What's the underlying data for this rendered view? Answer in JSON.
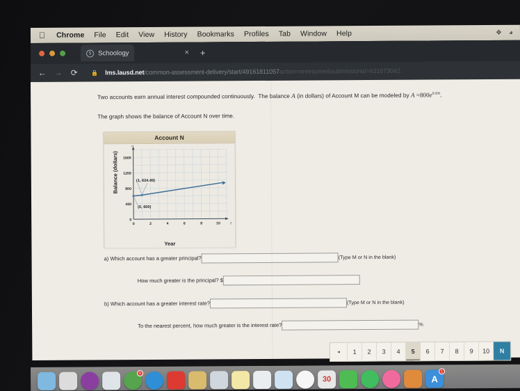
{
  "menubar": {
    "apple_glyph": "",
    "items": [
      {
        "label": "Chrome",
        "bold": true
      },
      {
        "label": "File",
        "bold": false
      },
      {
        "label": "Edit",
        "bold": false
      },
      {
        "label": "View",
        "bold": false
      },
      {
        "label": "History",
        "bold": false
      },
      {
        "label": "Bookmarks",
        "bold": false
      },
      {
        "label": "Profiles",
        "bold": false
      },
      {
        "label": "Tab",
        "bold": false
      },
      {
        "label": "Window",
        "bold": false
      },
      {
        "label": "Help",
        "bold": false
      }
    ],
    "status_icons": [
      "bluetooth-icon",
      "wifi-icon"
    ],
    "bluetooth_glyph": "ᛗ",
    "wifi_glyph": "◔"
  },
  "browser": {
    "tab": {
      "title": "Schoology",
      "favicon_letter": "S",
      "close_glyph": "×"
    },
    "new_tab_glyph": "+",
    "back_glyph": "←",
    "forward_glyph": "→",
    "reload_glyph": "⟳",
    "lock_glyph": "🔒",
    "url_domain": "lms.lausd.net",
    "url_path": "/common-assessment-delivery/start/49161811057",
    "url_query": "action=onresume&submissionid=631673042"
  },
  "problem": {
    "line1_a": "Two accounts earn annual interest compounded continuously.",
    "line1_b": "The balance",
    "var_A": "A",
    "line1_c": "(in dollars) of Account M can be modeled by",
    "formula_lhs": "A",
    "formula_eq": "=",
    "formula_coeff": "800",
    "formula_base": "e",
    "formula_exponent": "0.03t",
    "formula_period": ".",
    "line2": "The graph shows the balance of Account N over time."
  },
  "chart_data": {
    "type": "line",
    "title": "Account N",
    "xlabel": "Year",
    "ylabel": "Balance (dollars)",
    "x_axis_var": "t",
    "y_axis_var": "A",
    "xlim": [
      0,
      11
    ],
    "ylim": [
      0,
      1800
    ],
    "xticks": [
      0,
      2,
      4,
      6,
      8,
      10
    ],
    "yticks": [
      0,
      400,
      800,
      1200,
      1600
    ],
    "grid": true,
    "grid_color": "#a8c4d8",
    "line_color": "#3d6e96",
    "series": [
      {
        "name": "Account N balance",
        "x": [
          0,
          1,
          10.6
        ],
        "values": [
          600,
          624.49,
          936
        ]
      }
    ],
    "annotations": [
      {
        "label": "(1, 624.49)",
        "point_x": 1,
        "point_y": 624.49
      },
      {
        "label": "(0, 600)",
        "point_x": 0,
        "point_y": 600
      }
    ],
    "legend": "none"
  },
  "questions": {
    "a_marker": "a)",
    "a_text": "Which account has a greater principal?",
    "a_note": "(Type M or N in the blank)",
    "a_value": "",
    "a2_text": "How much greater is the principal?",
    "a2_prefix": "$",
    "a2_value": "",
    "b_marker": "b)",
    "b_text": "Which account has a greater interest rate?",
    "b_note": "(Type M or N in the blank)",
    "b_value": "",
    "b2_text": "To the nearest percent, how much greater is the interest rate?",
    "b2_suffix": "%",
    "b2_value": ""
  },
  "pager": {
    "prev_glyph": "◂",
    "pages": [
      "1",
      "2",
      "3",
      "4",
      "5",
      "6",
      "7",
      "8",
      "9",
      "10"
    ],
    "active_page": "5",
    "next_label": "N"
  },
  "dock": {
    "items": [
      {
        "name": "finder-icon",
        "color": "#7fb9e0",
        "glyph": ""
      },
      {
        "name": "launchpad-icon",
        "color": "#dcdcdc",
        "glyph": ""
      },
      {
        "name": "siri-icon",
        "color": "#8a3fa0",
        "glyph": ""
      },
      {
        "name": "mail-icon",
        "color": "#dfe4e8",
        "glyph": ""
      },
      {
        "name": "chrome-icon",
        "color": "#57a44e",
        "glyph": "",
        "badge": "9"
      },
      {
        "name": "safari-icon",
        "color": "#2f8fd6",
        "glyph": ""
      },
      {
        "name": "youtube-icon",
        "color": "#dd3a32",
        "glyph": ""
      },
      {
        "name": "folder-icon",
        "color": "#d9bb6e",
        "glyph": ""
      },
      {
        "name": "contacts-icon",
        "color": "#cfd6dd",
        "glyph": ""
      },
      {
        "name": "notes-icon",
        "color": "#f3e7a8",
        "glyph": ""
      },
      {
        "name": "reminders-icon",
        "color": "#e9edf0",
        "glyph": ""
      },
      {
        "name": "numbers-icon",
        "color": "#cfe2f2",
        "glyph": ""
      },
      {
        "name": "photos-icon",
        "color": "#f6f6f6",
        "glyph": ""
      },
      {
        "name": "calendar-icon",
        "color": "#e8e8e8",
        "glyph": "30"
      },
      {
        "name": "messages-icon",
        "color": "#4fbb53",
        "glyph": ""
      },
      {
        "name": "spotify-icon",
        "color": "#3fbd5f",
        "glyph": ""
      },
      {
        "name": "music-icon",
        "color": "#f06a9e",
        "glyph": ""
      },
      {
        "name": "books-icon",
        "color": "#e08a3c",
        "glyph": ""
      },
      {
        "name": "app-store-icon",
        "color": "#3c8fd8",
        "glyph": "A",
        "badge": "1"
      }
    ]
  }
}
